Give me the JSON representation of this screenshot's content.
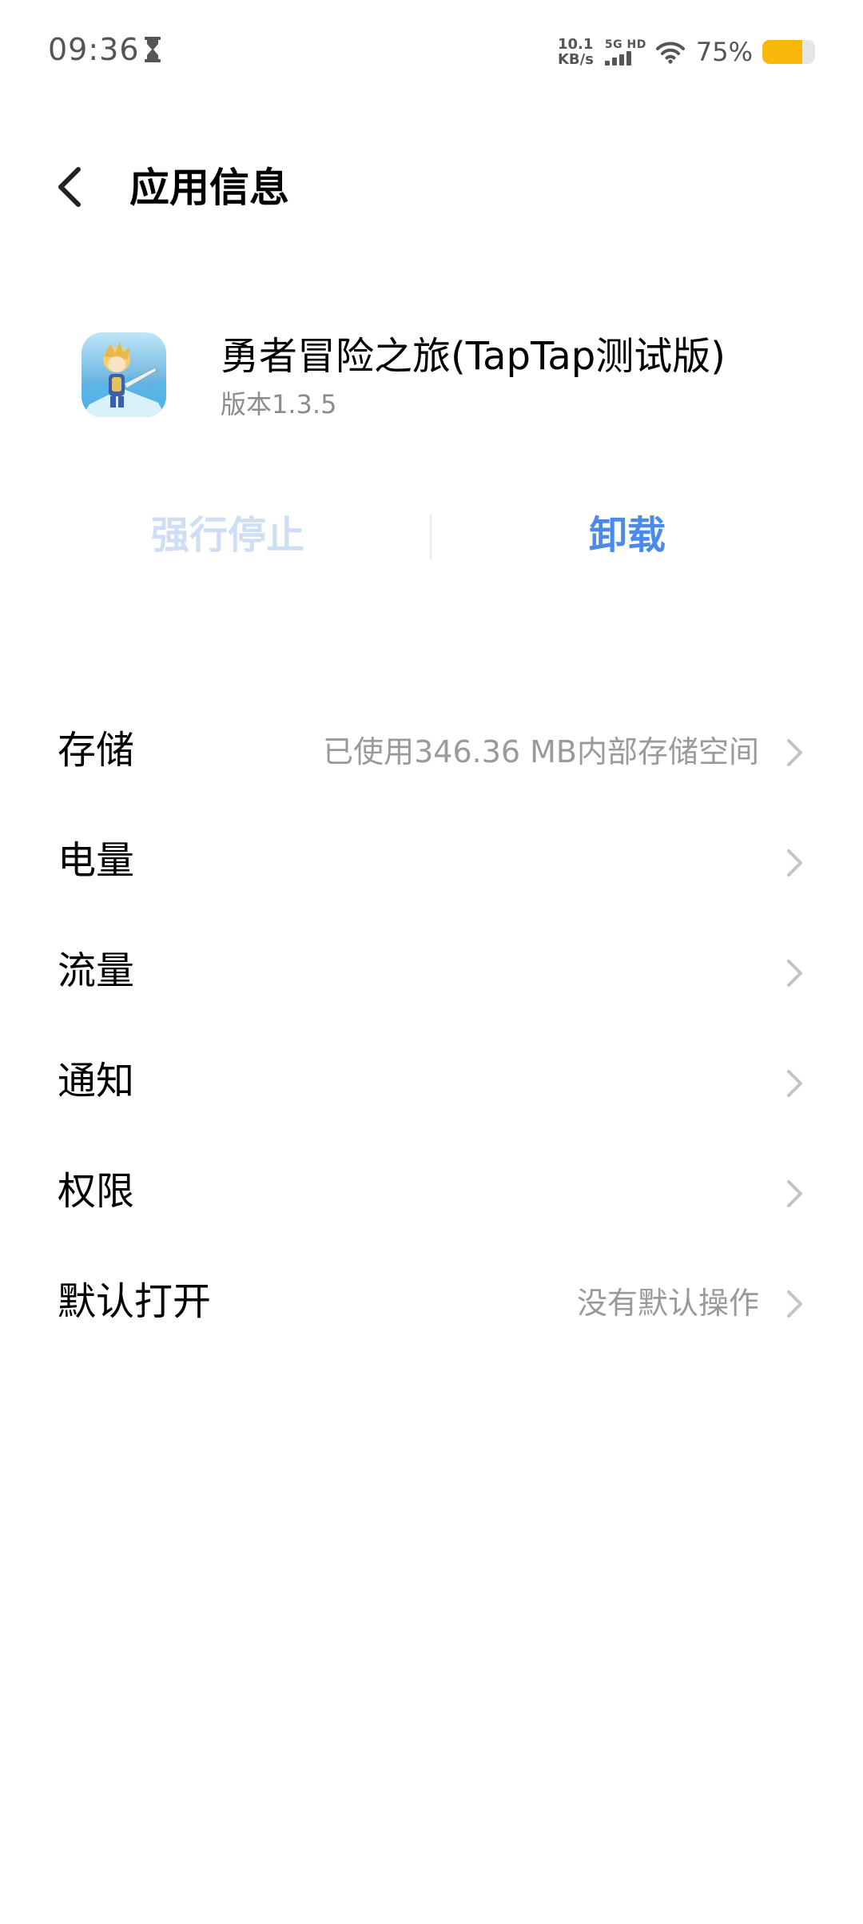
{
  "status_bar": {
    "time": "09:36",
    "net_speed_value": "10.1",
    "net_speed_unit": "KB/s",
    "network_type": "5G HD",
    "battery_percent": "75%",
    "battery_level": 0.75,
    "battery_color": "#f8b80a",
    "icons": [
      "hourglass-icon",
      "signal-icon",
      "wifi-icon",
      "battery-icon"
    ]
  },
  "header": {
    "back_icon": "chevron-left-icon",
    "title": "应用信息"
  },
  "app": {
    "name": "勇者冒险之旅(TapTap测试版)",
    "version": "版本1.3.5"
  },
  "actions": {
    "force_stop": "强行停止",
    "uninstall": "卸载",
    "force_stop_color": "#cfdef5",
    "uninstall_color": "#4a8ae8"
  },
  "settings": [
    {
      "label": "存储",
      "value": "已使用346.36 MB内部存储空间"
    },
    {
      "label": "电量",
      "value": ""
    },
    {
      "label": "流量",
      "value": ""
    },
    {
      "label": "通知",
      "value": ""
    },
    {
      "label": "权限",
      "value": ""
    },
    {
      "label": "默认打开",
      "value": "没有默认操作"
    }
  ]
}
